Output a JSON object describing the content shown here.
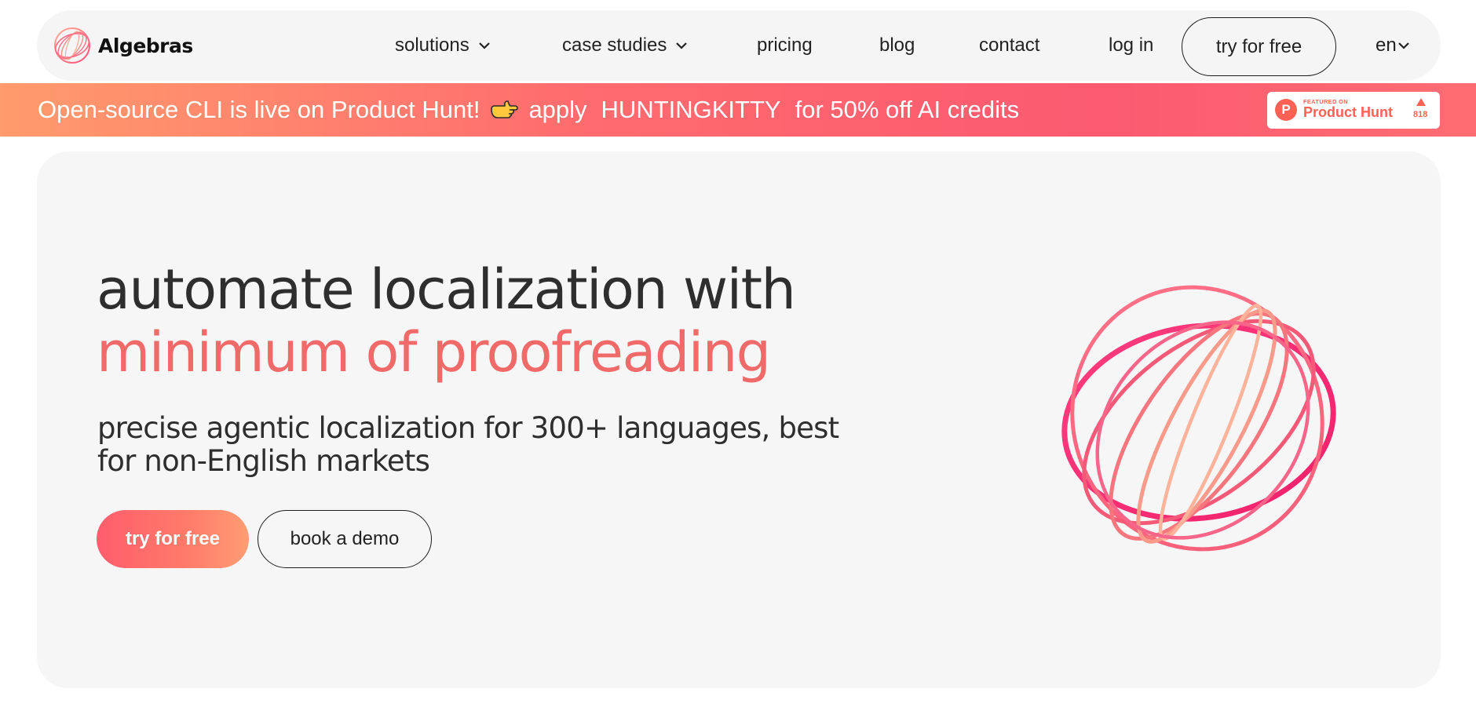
{
  "brand": {
    "name": "Algebras",
    "logo_icon": "sphere-logo-icon"
  },
  "nav": {
    "items": [
      {
        "label": "solutions",
        "has_dropdown": true
      },
      {
        "label": "case studies",
        "has_dropdown": true
      },
      {
        "label": "pricing",
        "has_dropdown": false
      },
      {
        "label": "blog",
        "has_dropdown": false
      },
      {
        "label": "contact",
        "has_dropdown": false
      },
      {
        "label": "log in",
        "has_dropdown": false
      }
    ],
    "cta_label": "try for free",
    "language": "en"
  },
  "promo": {
    "text_before": "Open-source CLI is live on Product Hunt!",
    "icon": "pointing-hand-icon",
    "apply_label": "apply",
    "code": "HUNTINGKITTY",
    "text_after": "for 50% off AI credits",
    "badge": {
      "small_text": "FEATURED ON",
      "name": "Product Hunt",
      "logo_letter": "P",
      "upvotes": "818"
    }
  },
  "hero": {
    "title_line1": "automate localization with",
    "title_line2": "minimum of proofreading",
    "subtitle": "precise agentic localization for 300+ languages, best for non-English markets",
    "primary_button": "try for free",
    "secondary_button": "book a demo",
    "graphic": "wireframe-sphere-graphic"
  },
  "colors": {
    "accent": "#f06a69",
    "promo_start": "#ff9b6d",
    "promo_end": "#fb5a70",
    "product_hunt": "#ff6154",
    "nav_bg": "#f5f5f5",
    "hero_bg": "#f6f6f6",
    "text_dark": "#2e2e2e"
  }
}
